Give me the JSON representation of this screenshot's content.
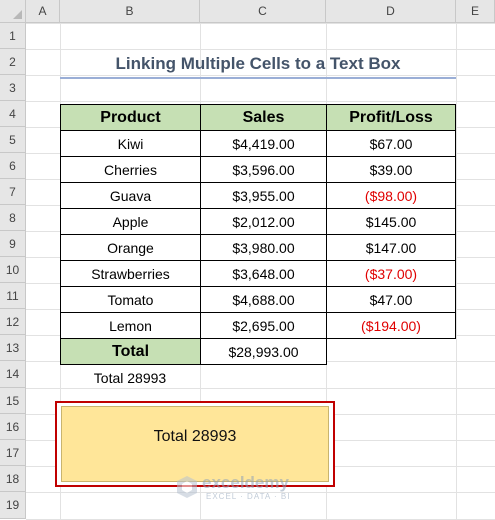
{
  "columns": [
    "A",
    "B",
    "C",
    "D",
    "E"
  ],
  "rows": [
    "1",
    "2",
    "3",
    "4",
    "5",
    "6",
    "7",
    "8",
    "9",
    "10",
    "11",
    "12",
    "13",
    "14",
    "15",
    "16",
    "17",
    "18",
    "19"
  ],
  "title": "Linking Multiple Cells to a Text Box",
  "table": {
    "headers": [
      "Product",
      "Sales",
      "Profit/Loss"
    ],
    "rows": [
      {
        "product": "Kiwi",
        "sales": "$4,419.00",
        "profit": "$67.00",
        "negative": false
      },
      {
        "product": "Cherries",
        "sales": "$3,596.00",
        "profit": "$39.00",
        "negative": false
      },
      {
        "product": "Guava",
        "sales": "$3,955.00",
        "profit": "($98.00)",
        "negative": true
      },
      {
        "product": "Apple",
        "sales": "$2,012.00",
        "profit": "$145.00",
        "negative": false
      },
      {
        "product": "Orange",
        "sales": "$3,980.00",
        "profit": "$147.00",
        "negative": false
      },
      {
        "product": "Strawberries",
        "sales": "$3,648.00",
        "profit": "($37.00)",
        "negative": true
      },
      {
        "product": "Tomato",
        "sales": "$4,688.00",
        "profit": "$47.00",
        "negative": false
      },
      {
        "product": "Lemon",
        "sales": "$2,695.00",
        "profit": "($194.00)",
        "negative": true
      }
    ],
    "total_label": "Total",
    "total_value": "$28,993.00"
  },
  "total_text": "Total 28993",
  "text_box": "Total 28993",
  "watermark": {
    "name": "exceldemy",
    "tagline": "EXCEL · DATA · BI",
    "icon": "exceldemy-logo-icon"
  },
  "colors": {
    "header_fill": "#c6e0b4",
    "negative": "#e00000",
    "textbox_fill": "#ffe699",
    "textbox_border": "#c00000",
    "title": "#44546a"
  }
}
